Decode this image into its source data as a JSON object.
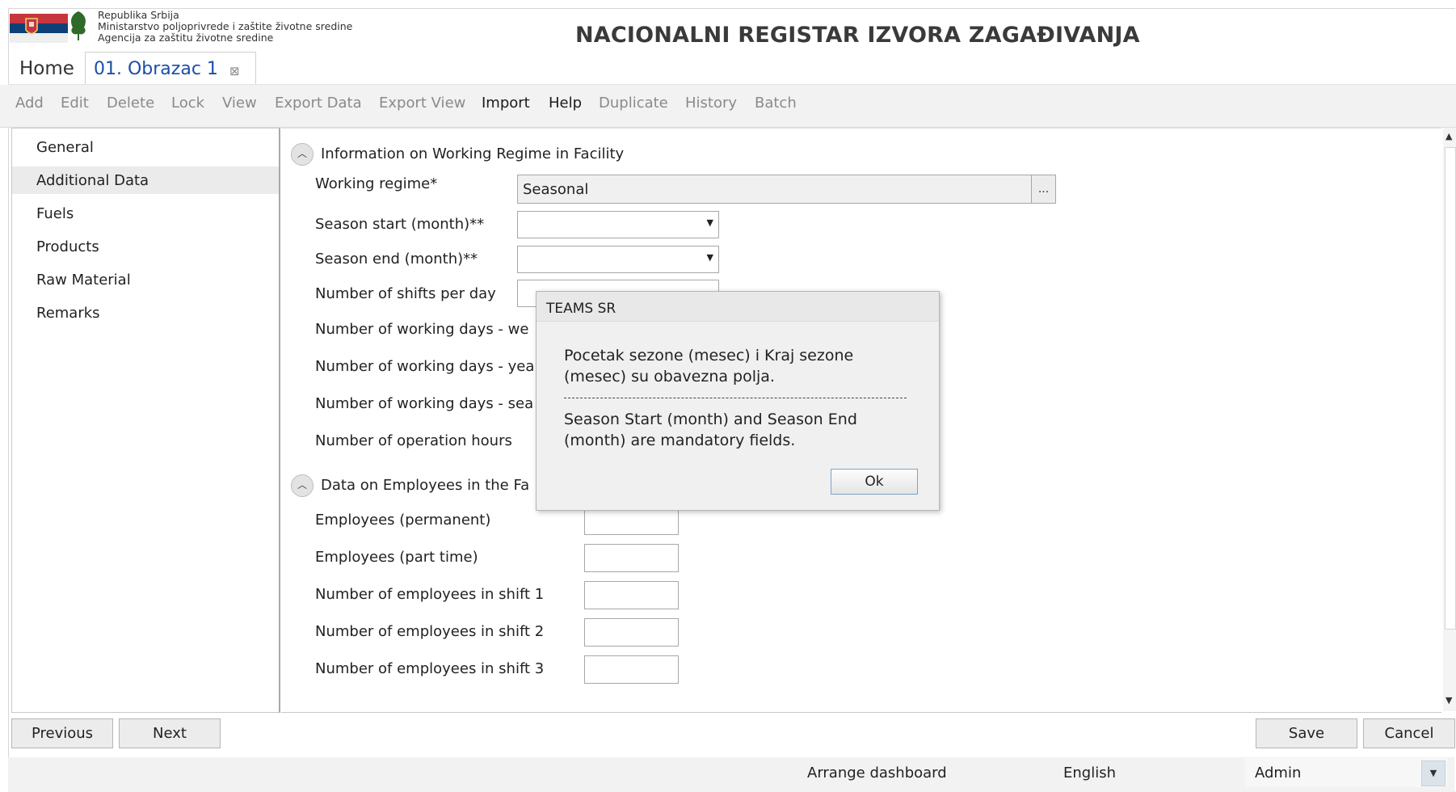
{
  "header": {
    "org_lines": [
      "Republika Srbija",
      "Ministarstvo poljoprivrede i zaštite životne sredine",
      "Agencija za zaštitu životne sredine"
    ],
    "title": "NACIONALNI REGISTAR IZVORA ZAGAĐIVANJA"
  },
  "tabs": {
    "home": "Home",
    "active": "01. Obrazac 1",
    "close_icon": "⊠"
  },
  "toolbar": [
    {
      "label": "Add",
      "enabled": false
    },
    {
      "label": "Edit",
      "enabled": false
    },
    {
      "label": "Delete",
      "enabled": false
    },
    {
      "label": "Lock",
      "enabled": false
    },
    {
      "label": "View",
      "enabled": false
    },
    {
      "label": "Export Data",
      "enabled": false
    },
    {
      "label": "Export View",
      "enabled": false
    },
    {
      "label": "Import",
      "enabled": true
    },
    {
      "label": "Help",
      "enabled": true
    },
    {
      "label": "Duplicate",
      "enabled": false
    },
    {
      "label": "History",
      "enabled": false
    },
    {
      "label": "Batch",
      "enabled": false
    }
  ],
  "nav": {
    "items": [
      "General",
      "Additional Data",
      "Fuels",
      "Products",
      "Raw Material",
      "Remarks"
    ],
    "selected": "Additional Data"
  },
  "section1": {
    "title": "Information on Working Regime in Facility",
    "working_regime_label": "Working regime*",
    "working_regime_value": "Seasonal",
    "ellipsis": "...",
    "season_start_label": "Season start (month)**",
    "season_end_label": "Season end (month)**",
    "shifts_label": "Number of shifts per day",
    "days_week_label": "Number of working days - we",
    "days_year_label": "Number of working days - yea",
    "days_season_label": "Number of working days - sea",
    "op_hours_label": "Number of operation hours"
  },
  "section2": {
    "title": "Data on Employees in the Fa",
    "permanent_label": "Employees (permanent)",
    "part_time_label": "Employees (part time)",
    "shift1_label": "Number of employees in shift 1",
    "shift2_label": "Number of employees in shift 2",
    "shift3_label": "Number of employees in shift 3"
  },
  "dialog": {
    "title": "TEAMS SR",
    "msg_sr_1": "Pocetak sezone (mesec) i Kraj sezone",
    "msg_sr_2": "(mesec) su obavezna polja.",
    "msg_en_1": "Season Start (month) and Season End",
    "msg_en_2": "(month) are  mandatory fields.",
    "ok": "Ok"
  },
  "footer": {
    "previous": "Previous",
    "next": "Next",
    "save": "Save",
    "cancel": "Cancel",
    "arrange": "Arrange dashboard",
    "language": "English",
    "user": "Admin"
  },
  "colors": {
    "accent": "#1a4ea6",
    "toolbar_bg": "#f2f2f2",
    "selected_nav": "#ebebeb"
  }
}
